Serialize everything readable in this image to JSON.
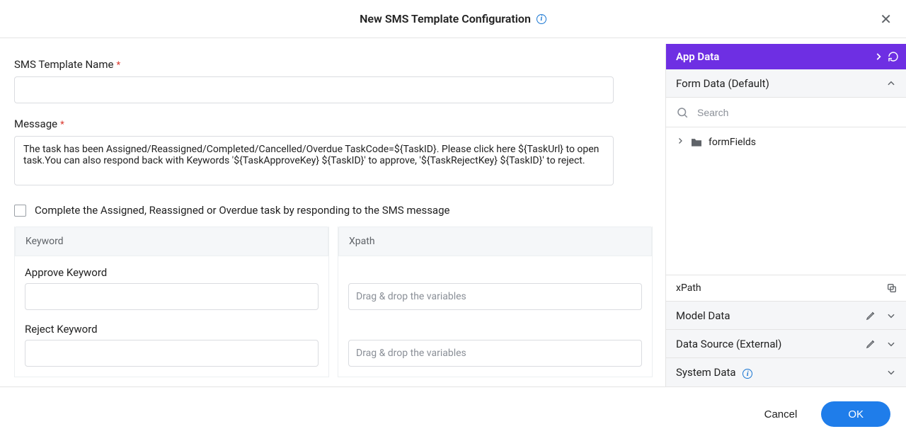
{
  "header": {
    "title": "New SMS Template Configuration"
  },
  "form": {
    "templateName": {
      "label": "SMS Template Name",
      "value": ""
    },
    "message": {
      "label": "Message",
      "value": "The task has been Assigned/Reassigned/Completed/Cancelled/Overdue TaskCode=${TaskID}. Please click here ${TaskUrl} to open task.You can also respond back with Keywords '${TaskApproveKey} ${TaskID}' to approve, '${TaskRejectKey} ${TaskID}' to reject."
    },
    "completeCheckbox": {
      "label": "Complete the Assigned, Reassigned or Overdue task by responding to the SMS message",
      "checked": false
    },
    "columns": {
      "left": {
        "header": "Keyword"
      },
      "right": {
        "header": "Xpath"
      }
    },
    "approveKeyword": {
      "label": "Approve Keyword",
      "value": "",
      "xpathPlaceholder": "Drag & drop the variables"
    },
    "rejectKeyword": {
      "label": "Reject Keyword",
      "value": "",
      "xpathPlaceholder": "Drag & drop the variables"
    }
  },
  "sidebar": {
    "title": "App Data",
    "sections": {
      "formData": {
        "label": "Form Data (Default)",
        "searchPlaceholder": "Search",
        "tree": {
          "root": "formFields"
        },
        "xpathLabel": "xPath"
      },
      "modelData": {
        "label": "Model Data"
      },
      "dataSource": {
        "label": "Data Source (External)"
      },
      "systemData": {
        "label": "System Data"
      }
    }
  },
  "footer": {
    "cancel": "Cancel",
    "ok": "OK"
  }
}
